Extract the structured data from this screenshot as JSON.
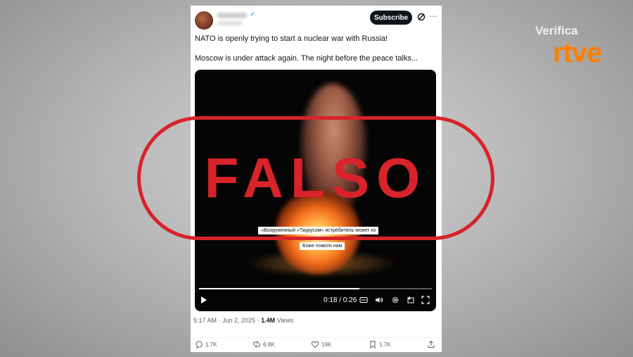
{
  "post": {
    "subscribe_label": "Subscribe",
    "text_line1": "NATO is openly trying to start a nuclear war with Russia!",
    "text_line2": "Moscow is under attack again. The night before the peace talks...",
    "timestamp": "5:17 AM · Jun 2, 2025 · ",
    "views_count": "1.4M",
    "views_label": " Views",
    "icons": {
      "verified": "verified-badge-icon",
      "grok": "grok-icon",
      "more": "more-icon"
    }
  },
  "video": {
    "caption_line1": "«Вооруженный «Таурусом» истребитель может из",
    "caption_line2": "Боже помоги нам",
    "time": "0:18 / 0:26",
    "progress": 0.69
  },
  "actions": {
    "replies": "1.7K",
    "reposts": "6.8K",
    "likes": "19K",
    "bookmarks": "1.7K"
  },
  "stamp": {
    "label": "FALSO",
    "color": "#d8232a"
  },
  "brand": {
    "line1": "Verifica",
    "line2": "rtve",
    "accent": "#ff7f00"
  }
}
